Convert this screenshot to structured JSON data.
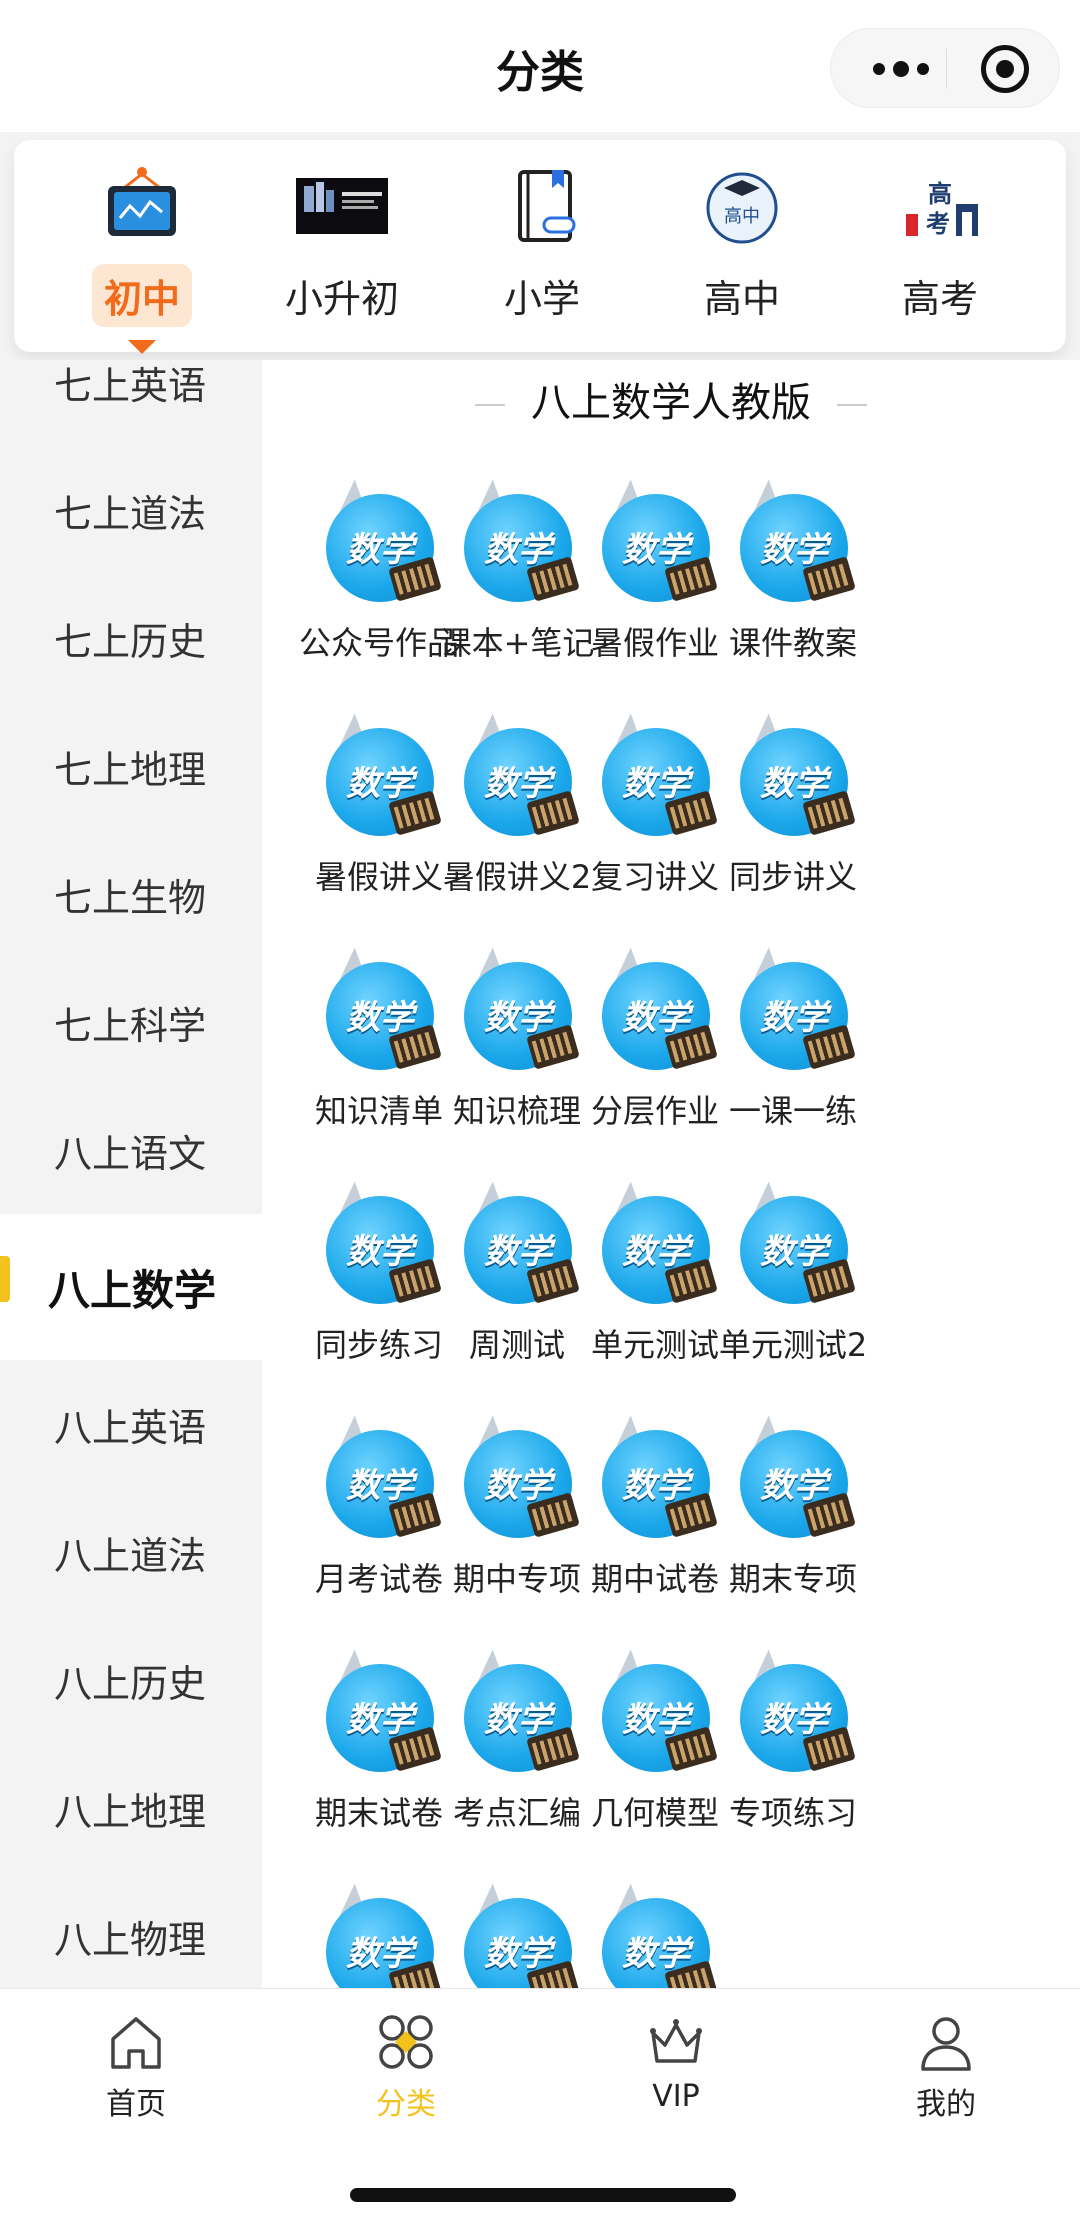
{
  "header": {
    "title": "分类"
  },
  "categories": [
    {
      "label": "初中",
      "icon": "monitor-chart-icon",
      "active": true
    },
    {
      "label": "小升初",
      "icon": "banner-image-icon",
      "active": false
    },
    {
      "label": "小学",
      "icon": "book-link-icon",
      "active": false
    },
    {
      "label": "高中",
      "icon": "graduation-badge-icon",
      "active": false
    },
    {
      "label": "高考",
      "icon": "gaokao-logo-icon",
      "active": false
    }
  ],
  "sidebar": {
    "items": [
      {
        "label": "七上英语"
      },
      {
        "label": "七上道法"
      },
      {
        "label": "七上历史"
      },
      {
        "label": "七上地理"
      },
      {
        "label": "七上生物"
      },
      {
        "label": "七上科学"
      },
      {
        "label": "八上语文"
      },
      {
        "label": "八上数学",
        "active": true
      },
      {
        "label": "八上英语"
      },
      {
        "label": "八上道法"
      },
      {
        "label": "八上历史"
      },
      {
        "label": "八上地理"
      },
      {
        "label": "八上物理"
      }
    ]
  },
  "main": {
    "section_title": "八上数学人教版",
    "icon_word": "数学",
    "items": [
      {
        "label": "公众号作品"
      },
      {
        "label": "课本+笔记"
      },
      {
        "label": "暑假作业"
      },
      {
        "label": "课件教案"
      },
      {
        "label": "暑假讲义"
      },
      {
        "label": "暑假讲义2"
      },
      {
        "label": "复习讲义"
      },
      {
        "label": "同步讲义"
      },
      {
        "label": "知识清单"
      },
      {
        "label": "知识梳理"
      },
      {
        "label": "分层作业"
      },
      {
        "label": "一课一练"
      },
      {
        "label": "同步练习"
      },
      {
        "label": "周测试"
      },
      {
        "label": "单元测试"
      },
      {
        "label": "单元测试2"
      },
      {
        "label": "月考试卷"
      },
      {
        "label": "期中专项"
      },
      {
        "label": "期中试卷"
      },
      {
        "label": "期末专项"
      },
      {
        "label": "期末试卷"
      },
      {
        "label": "考点汇编"
      },
      {
        "label": "几何模型"
      },
      {
        "label": "专项练习"
      },
      {
        "label": ""
      },
      {
        "label": ""
      },
      {
        "label": ""
      }
    ]
  },
  "tabbar": {
    "tabs": [
      {
        "label": "首页",
        "icon": "home-icon"
      },
      {
        "label": "分类",
        "icon": "category-icon",
        "active": true
      },
      {
        "label": "VIP",
        "icon": "crown-icon"
      },
      {
        "label": "我的",
        "icon": "user-icon"
      }
    ]
  },
  "colors": {
    "accent": "#f26a1b",
    "sidebar_indicator": "#f3c21e",
    "tab_active": "#f3c21e"
  }
}
